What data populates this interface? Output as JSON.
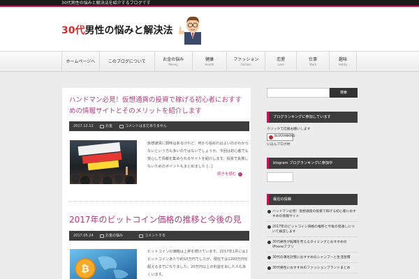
{
  "topbar": {
    "text": "30代男性の悩みと解決法を紹介するブログです"
  },
  "logo": {
    "accent": "30代",
    "main": "男性の悩みと解決法"
  },
  "nav": {
    "items": [
      {
        "label": "ホームページへ",
        "sub": ""
      },
      {
        "label": "このブログについて",
        "sub": ""
      },
      {
        "label": "お金の悩み",
        "sub": "Money"
      },
      {
        "label": "健康",
        "sub": "Health"
      },
      {
        "label": "ファッション",
        "sub": "Fashion"
      },
      {
        "label": "恋愛",
        "sub": "Love"
      },
      {
        "label": "仕事",
        "sub": "Work"
      },
      {
        "label": "趣味",
        "sub": "Hobby"
      }
    ]
  },
  "posts": [
    {
      "title": "ハンドマン必見！仮想通貨の投資で稼げる初心者におすすめの情報サイトとそのメリットを紹介します",
      "date": "2017.12.12",
      "category": "お金",
      "comments": "コメントはまだありません",
      "excerpt": "仮想通貨に興味はあるけれど、何から始めればよいのかわからないという方も多いのではないでしょうか。今回は初心者でも安心して情報を集められるサイトを紹介します。投資で失敗しないためのポイントもまとめました [...]",
      "more": "続きを読む"
    },
    {
      "title": "2017年のビットコイン価格の推移と今後の見通しについて解説します",
      "date": "2017.05.24",
      "category": "お金の悩み",
      "comments": "コメントする",
      "excerpt": "ビットコインの価格は上昇を続けています。2017年1月には1ビットコインあたり約10万円でしたが、現在では1200万円を超えるまでになりました。20万円以上の利益を出した人も多くいます。"
    }
  ],
  "sidebar": {
    "search_button": "検索",
    "search_placeholder": "",
    "widget1_title": "ブログランキングに参加しています",
    "widget1_text": "クリックで応援お願いします",
    "rank_badge": "BLOGRANKING",
    "widget1_link": "にほんブログ村",
    "widget2_title": "blogram ブログランキングに参加中",
    "recent_title": "最近の投稿",
    "recent": [
      "ハンドマン必見！仮想通貨の投資で稼げる初心者におすすめの情報サイト",
      "2017年のビットコイン価格の推移と今後の見通しについて解説します",
      "30代男性が転職を考えるタイミングとおすすめのiPhoneアプリ",
      "30代の薄毛対策におすすめのシャンプーと生活習慣",
      "30代男性におすすめのファッションブランドまとめ"
    ]
  },
  "colors": {
    "accent": "#c2185b",
    "title": "#b03a7a",
    "dark_bar": "#3c3c3c"
  }
}
